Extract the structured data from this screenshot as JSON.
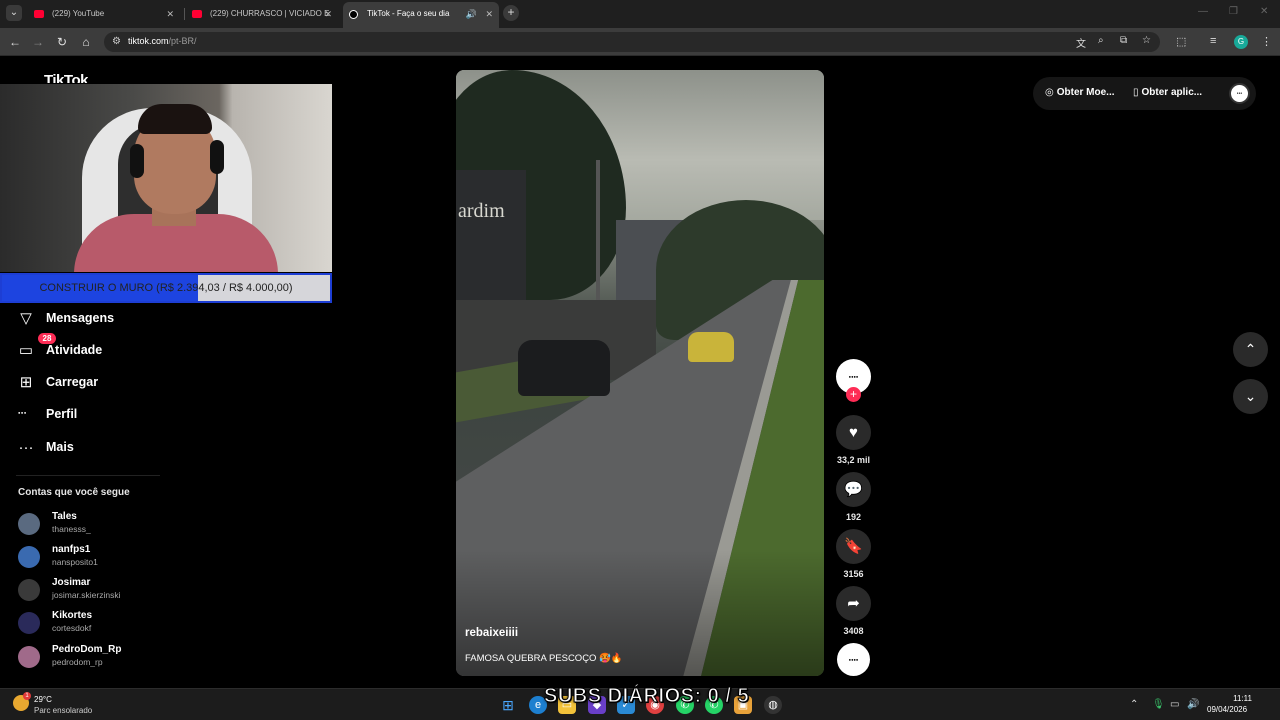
{
  "browser": {
    "tabs": [
      {
        "title": "(229) YouTube",
        "active": false
      },
      {
        "title": "(229) CHURRASCO | VICIADO E",
        "active": false
      },
      {
        "title": "TikTok - Faça o seu dia",
        "active": true
      }
    ],
    "url_host": "tiktok.com",
    "url_path": "/pt-BR/",
    "profile_initial": "G"
  },
  "tiktok": {
    "logo": "TikTok",
    "stream_goal": {
      "text": "CONSTRUIR O MURO (R$ 2.394,03 / R$ 4.000,00)",
      "current": 2394.03,
      "target": 4000.0
    },
    "menu": [
      {
        "label": "Mensagens",
        "icon": "send-icon"
      },
      {
        "label": "Atividade",
        "icon": "inbox-icon",
        "badge": "28"
      },
      {
        "label": "Carregar",
        "icon": "upload-icon"
      },
      {
        "label": "Perfil",
        "icon": "profile-icon"
      },
      {
        "label": "Mais",
        "icon": "more-icon"
      }
    ],
    "profile_short": "",
    "following_title": "Contas que você segue",
    "following": [
      {
        "name": "Tales",
        "username": "thanesss_"
      },
      {
        "name": "nanfps1",
        "username": "nansposito1"
      },
      {
        "name": "Josimar",
        "username": "josimar.skierzinski"
      },
      {
        "name": "Kikortes",
        "username": "cortesdokf"
      },
      {
        "name": "PedroDom_Rp",
        "username": "pedrodom_rp"
      }
    ],
    "video": {
      "author": "rebaixeiiii",
      "caption": "FAMOSA QUEBRA PESCOÇO 🥵🔥",
      "scene_sign_text": "ardim"
    },
    "actions": {
      "likes": "33,2 mil",
      "comments": "192",
      "saves": "3156",
      "shares": "3408"
    },
    "top_actions": {
      "coins": "Obter Moe...",
      "app": "Obter aplic..."
    }
  },
  "overlay": {
    "subs_text": "SUBS DIÁRIOS: 0 / 5"
  },
  "taskbar": {
    "weather_temp": "29°C",
    "weather_desc": "Parc ensolarado",
    "weather_badge": "1",
    "time": "11:11",
    "date": "09/04/2026"
  }
}
